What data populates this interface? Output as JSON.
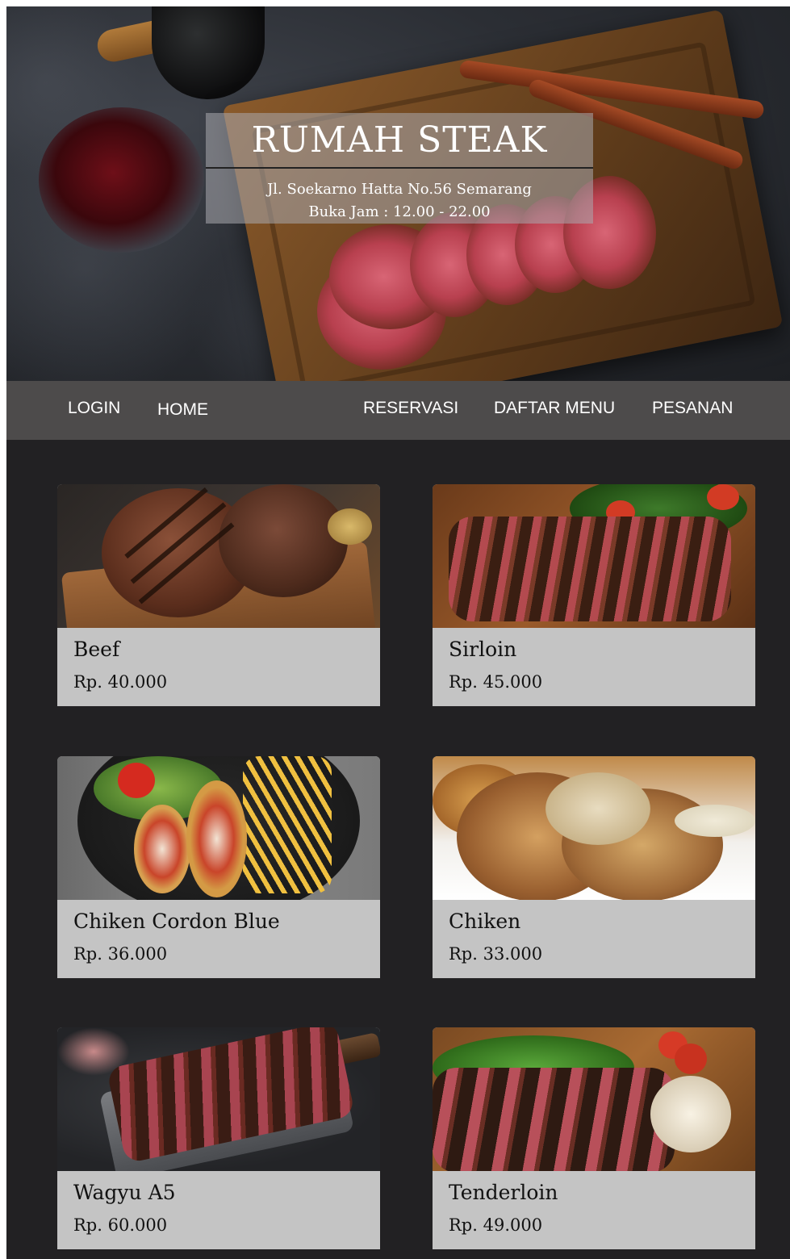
{
  "hero": {
    "title": "RUMAH STEAK",
    "address": "Jl. Soekarno Hatta No.56 Semarang",
    "hours": "Buka Jam : 12.00 - 22.00"
  },
  "nav": {
    "items": [
      {
        "label": "LOGIN"
      },
      {
        "label": "HOME"
      },
      {
        "label": "RESERVASI"
      },
      {
        "label": "DAFTAR MENU"
      },
      {
        "label": "PESANAN"
      }
    ]
  },
  "menu": {
    "items": [
      {
        "name": "Beef",
        "price": "Rp. 40.000"
      },
      {
        "name": "Sirloin",
        "price": "Rp. 45.000"
      },
      {
        "name": "Chiken Cordon Blue",
        "price": "Rp. 36.000"
      },
      {
        "name": "Chiken",
        "price": "Rp. 33.000"
      },
      {
        "name": "Wagyu A5",
        "price": "Rp. 60.000"
      },
      {
        "name": "Tenderloin",
        "price": "Rp. 49.000"
      }
    ]
  },
  "colors": {
    "page_background": "#222123",
    "nav_background": "#4d4b4b",
    "card_background": "#c4c4c4",
    "nav_text": "#ffffff"
  }
}
